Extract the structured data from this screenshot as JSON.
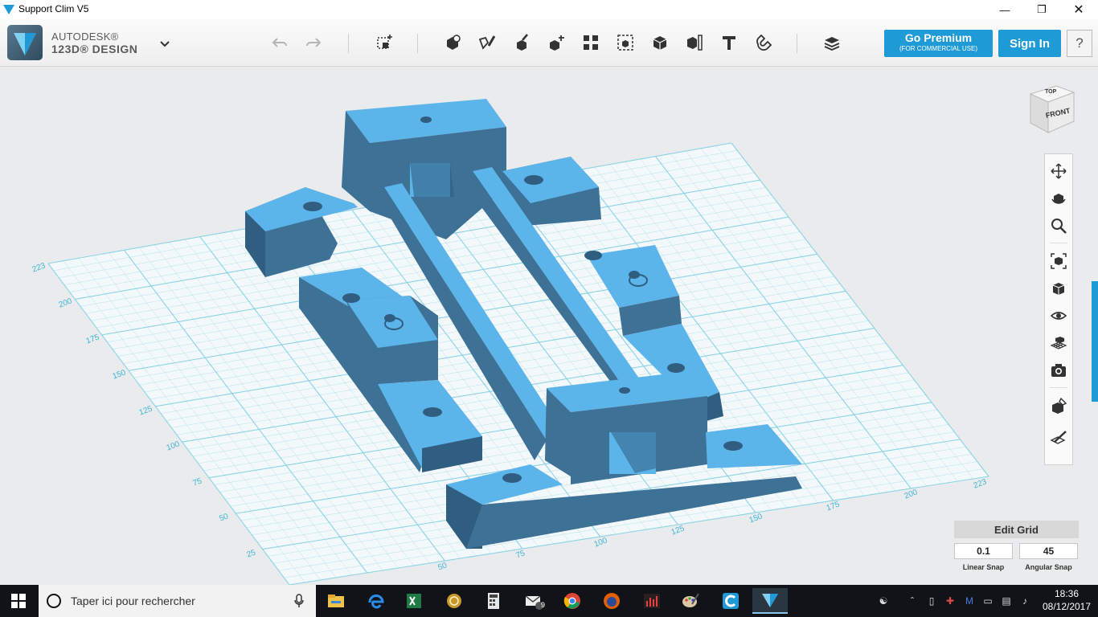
{
  "window": {
    "title": "Support Clim V5",
    "controls": [
      "minimize-icon",
      "maximize-icon",
      "close-icon"
    ]
  },
  "toolbar": {
    "brand_line1": "AUTODESK®",
    "brand_line2": "123D® DESIGN",
    "tools": [
      "undo-icon",
      "redo-icon",
      "transform-icon",
      "primitives-icon",
      "sketch-icon",
      "construct-icon",
      "modify-icon",
      "pattern-icon",
      "group-icon",
      "combine-icon",
      "measure-icon",
      "text-icon",
      "snap-icon",
      "material-icon"
    ],
    "premium_label": "Go Premium",
    "premium_sublabel": "(FOR COMMERCIAL USE)",
    "signin_label": "Sign In",
    "help_label": "?"
  },
  "viewcube": {
    "top": "TOP",
    "front": "FRONT"
  },
  "navbar": {
    "items": [
      "pan-icon",
      "orbit-icon",
      "zoom-icon",
      "fit-icon",
      "view-icon",
      "visibility-icon",
      "grid-icon",
      "screenshot-icon",
      "material-icon",
      "edit-grid-icon"
    ]
  },
  "grid_axis": {
    "left_labels": [
      "223",
      "200",
      "175",
      "150",
      "125",
      "100",
      "75",
      "50",
      "25"
    ],
    "bottom_labels": [
      "50",
      "75",
      "100",
      "125",
      "150",
      "175",
      "200",
      "223"
    ]
  },
  "edit_grid": {
    "title": "Edit Grid",
    "linear_value": "0.1",
    "angular_value": "45",
    "linear_label": "Linear Snap",
    "angular_label": "Angular Snap"
  },
  "taskbar": {
    "search_placeholder": "Taper ici pour rechercher",
    "mail_badge": "9",
    "time": "18:36",
    "date": "08/12/2017"
  },
  "colors": {
    "accent": "#1e9ad6",
    "grid": "#7fd0e6",
    "model_top": "#5bb4ea",
    "model_side": "#3d7196",
    "model_front": "#2f5e80"
  }
}
